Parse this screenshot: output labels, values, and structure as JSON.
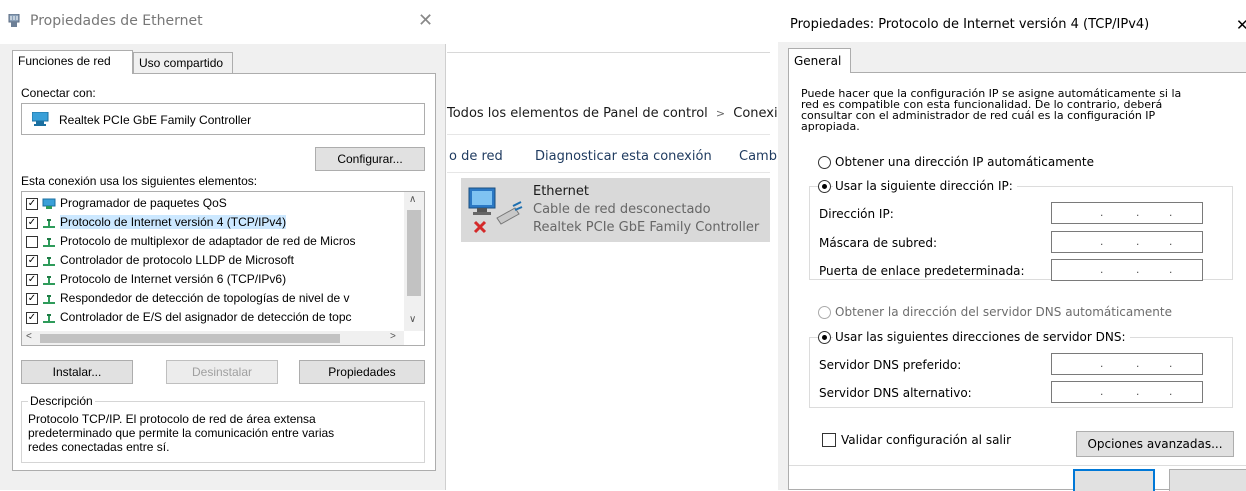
{
  "left_dialog": {
    "title": "Propiedades de Ethernet",
    "close": "✕",
    "tabs": [
      {
        "label": "Funciones de red"
      },
      {
        "label": "Uso compartido"
      }
    ],
    "connect_with_label": "Conectar con:",
    "adapter_name": "Realtek PCIe GbE Family Controller",
    "configure_button": "Configurar...",
    "elements_label": "Esta conexión usa los siguientes elementos:",
    "items": [
      {
        "checked": "✓",
        "label": "Programador de paquetes QoS"
      },
      {
        "checked": "✓",
        "label": "Protocolo de Internet versión 4 (TCP/IPv4)"
      },
      {
        "checked": "",
        "label": "Protocolo de multiplexor de adaptador de red de Micros"
      },
      {
        "checked": "✓",
        "label": "Controlador de protocolo LLDP de Microsoft"
      },
      {
        "checked": "✓",
        "label": "Protocolo de Internet versión 6 (TCP/IPv6)"
      },
      {
        "checked": "✓",
        "label": "Respondedor de detección de topologías de nivel de v"
      },
      {
        "checked": "✓",
        "label": "Controlador de E/S del asignador de detección de topc"
      }
    ],
    "scroll_up": "∧",
    "scroll_down": "∨",
    "scroll_left": "<",
    "scroll_right": ">",
    "install_button": "Instalar...",
    "uninstall_button": "Desinstalar",
    "properties_button": "Propiedades",
    "description_legend": "Descripción",
    "description_lines": [
      "Protocolo TCP/IP. El protocolo de red de área extensa",
      "predeterminado que permite la comunicación entre varias",
      "redes conectadas entre sí."
    ]
  },
  "middle": {
    "breadcrumb": "Todos los elementos de Panel de control",
    "breadcrumb_sep": ">",
    "breadcrumb_next": "Conexi",
    "toolbar": {
      "item1": "o de red",
      "item2": "Diagnosticar esta conexión",
      "item3": "Camb"
    },
    "connection": {
      "name": "Ethernet",
      "status": "Cable de red desconectado",
      "adapter": "Realtek PCIe GbE Family Controller"
    }
  },
  "right_dialog": {
    "title": "Propiedades: Protocolo de Internet versión 4 (TCP/IPv4)",
    "close": "✕",
    "tab": "General",
    "intro_lines": [
      "Puede hacer que la configuración IP se asigne automáticamente si la",
      "red es compatible con esta funcionalidad. De lo contrario, deberá",
      "consultar con el administrador de red cuál es la configuración IP",
      "apropiada."
    ],
    "auto_ip": "Obtener una dirección IP automáticamente",
    "manual_ip": "Usar la siguiente dirección IP:",
    "ip_address_label": "Dirección IP:",
    "subnet_label": "Máscara de subred:",
    "gateway_label": "Puerta de enlace predeterminada:",
    "auto_dns": "Obtener la dirección del servidor DNS automáticamente",
    "manual_dns": "Usar las siguientes direcciones de servidor DNS:",
    "preferred_dns_label": "Servidor DNS preferido:",
    "alternate_dns_label": "Servidor DNS alternativo:",
    "ip_dot": ".",
    "validate_label": "Validar configuración al salir",
    "advanced_button": "Opciones avanzadas..."
  },
  "colors": {
    "dialog_bg": "#f0f0f0",
    "selection": "#cce8ff",
    "button": "#e1e1e1",
    "border": "#adadad",
    "link": "#1e3a5f"
  }
}
